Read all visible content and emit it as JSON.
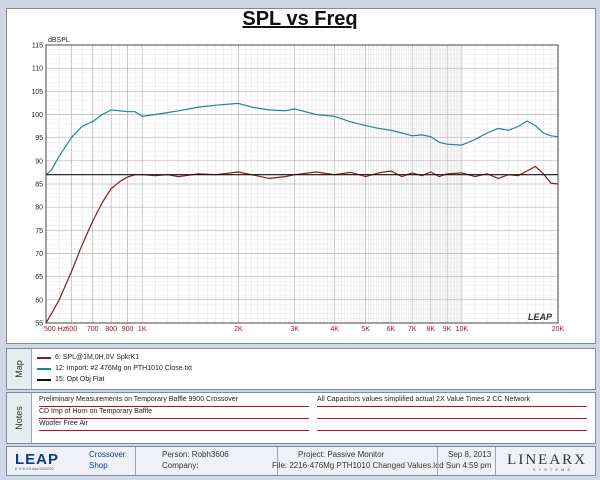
{
  "chart_data": {
    "type": "line",
    "title": "SPL vs Freq",
    "ylabel": "dBSPL",
    "xscale": "log",
    "xlim": [
      500,
      20000
    ],
    "ylim": [
      55,
      115
    ],
    "yticks": [
      115,
      110,
      105,
      100,
      95,
      90,
      85,
      80,
      75,
      70,
      65,
      60,
      55
    ],
    "xticks": [
      {
        "v": 500,
        "label": "500 Hz"
      },
      {
        "v": 600,
        "label": "600"
      },
      {
        "v": 700,
        "label": "700"
      },
      {
        "v": 800,
        "label": "800"
      },
      {
        "v": 900,
        "label": "900"
      },
      {
        "v": 1000,
        "label": "1K"
      },
      {
        "v": 2000,
        "label": "2K"
      },
      {
        "v": 3000,
        "label": "3K"
      },
      {
        "v": 4000,
        "label": "4K"
      },
      {
        "v": 5000,
        "label": "5K"
      },
      {
        "v": 6000,
        "label": "6K"
      },
      {
        "v": 7000,
        "label": "7K"
      },
      {
        "v": 8000,
        "label": "8K"
      },
      {
        "v": 9000,
        "label": "9K"
      },
      {
        "v": 10000,
        "label": "10K"
      },
      {
        "v": 20000,
        "label": "20K"
      }
    ],
    "series": [
      {
        "name": "6: SPL@1M,0H,0V SpkrK1",
        "color": "#8b1a1a",
        "x": [
          500,
          520,
          550,
          600,
          650,
          700,
          750,
          800,
          850,
          900,
          950,
          1000,
          1100,
          1200,
          1300,
          1500,
          1700,
          2000,
          2200,
          2500,
          2800,
          3000,
          3500,
          4000,
          4500,
          5000,
          5500,
          6000,
          6500,
          7000,
          7500,
          8000,
          8500,
          9000,
          10000,
          11000,
          12000,
          13000,
          14000,
          15000,
          16000,
          17000,
          18000,
          19000,
          20000
        ],
        "y": [
          55,
          57,
          60,
          66,
          72,
          77,
          81,
          84,
          85.5,
          86.5,
          87,
          87,
          86.8,
          87,
          86.6,
          87.2,
          87,
          87.6,
          87,
          86.2,
          86.6,
          87,
          87.6,
          87,
          87.5,
          86.6,
          87.4,
          87.8,
          86.6,
          87.4,
          86.8,
          87.6,
          86.6,
          87.2,
          87.4,
          86.6,
          87.2,
          86.2,
          87,
          86.8,
          87.8,
          88.8,
          87.2,
          85.2,
          85
        ]
      },
      {
        "name": "12: Import: #2 476Mg on PTH1010 Close.txt",
        "color": "#1a8a8a",
        "x": [
          500,
          520,
          550,
          600,
          650,
          700,
          750,
          800,
          850,
          900,
          950,
          1000,
          1100,
          1200,
          1300,
          1500,
          1700,
          2000,
          2200,
          2500,
          2800,
          3000,
          3500,
          4000,
          4500,
          5000,
          5500,
          6000,
          6500,
          7000,
          7500,
          8000,
          8500,
          9000,
          10000,
          11000,
          12000,
          13000,
          14000,
          15000,
          16000,
          17000,
          18000,
          19000,
          20000
        ],
        "y": [
          87,
          88,
          91,
          95,
          97.5,
          98.5,
          100,
          101,
          100.8,
          100.6,
          100.6,
          99.6,
          100,
          100.4,
          100.8,
          101.6,
          102,
          102.4,
          101.6,
          101,
          100.8,
          101.2,
          100,
          99.6,
          98.4,
          97.6,
          97,
          96.6,
          96,
          95.4,
          95.6,
          95.2,
          94,
          93.6,
          93.4,
          94.6,
          96,
          97,
          96.6,
          97.4,
          98.6,
          97.6,
          96,
          95.4,
          95.2
        ]
      },
      {
        "name": "15: Opt Obj Flat",
        "color": "#111111",
        "x": [
          500,
          20000
        ],
        "y": [
          87,
          87
        ]
      }
    ]
  },
  "map_entries": [
    {
      "label": "6: SPL@1M,0H,0V SpkrK1",
      "color": "#8b1a1a"
    },
    {
      "label": "12: Import: #2 476Mg on PTH1010 Close.txt",
      "color": "#1a8a8a"
    },
    {
      "label": "15: Opt Obj Flat",
      "color": "#111111"
    }
  ],
  "side_labels": {
    "map": "Map",
    "notes": "Notes"
  },
  "notes": {
    "left1": "Preliminary Measurements on Temporary Baffle  9900 Crossover",
    "left2": "CD Imp of Horn on Temporary Baffle",
    "left3": "Woofer Free Air",
    "right1": "All Capacitors values simplified actual 2X Value Times 2 CC Network"
  },
  "footer": {
    "logo": "LEAP",
    "logo_sub": "E X 5.XX   Apr/29/2007",
    "module1": "Crossover",
    "module2": "Shop",
    "person": "Person: Robh3606",
    "company": "Company:",
    "project": "Project: Passive Monitor",
    "file": "File: 2216-476Mg PTH1010 Changed Values.lcd",
    "date": "Sep  8, 2013",
    "time": "Sun  4:59 pm",
    "brand": "LINEARX",
    "brand_sub": "SYSTEMS"
  },
  "watermark": "LEAP"
}
